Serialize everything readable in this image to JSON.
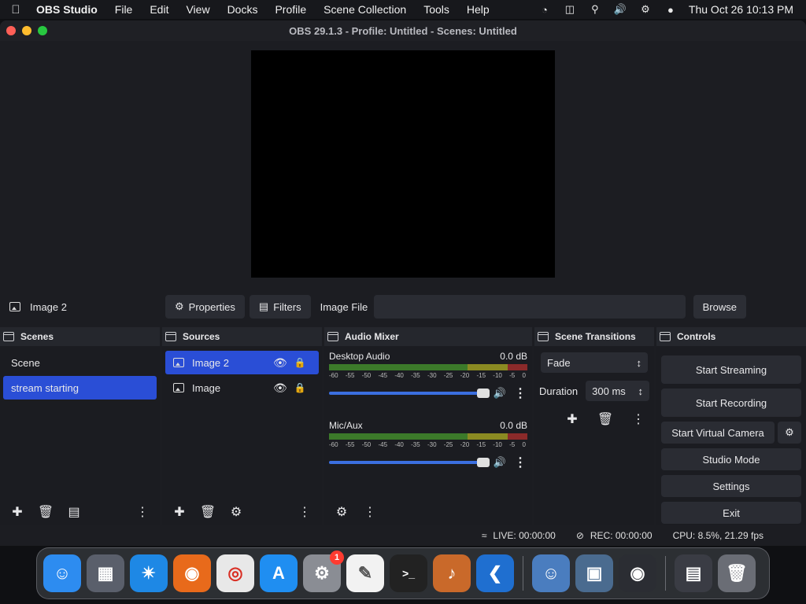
{
  "menubar": {
    "app_name": "OBS Studio",
    "menus": [
      "File",
      "Edit",
      "View",
      "Docks",
      "Profile",
      "Scene Collection",
      "Tools",
      "Help"
    ],
    "clock": "Thu Oct 26  10:13 PM"
  },
  "window": {
    "title": "OBS 29.1.3 - Profile: Untitled - Scenes: Untitled"
  },
  "source_toolbar": {
    "selected_source": "Image 2",
    "properties_label": "Properties",
    "filters_label": "Filters",
    "image_file_label": "Image File",
    "image_file_value": "",
    "browse_label": "Browse"
  },
  "scenes": {
    "title": "Scenes",
    "items": [
      "Scene",
      "stream starting"
    ],
    "selected_index": 1
  },
  "sources": {
    "title": "Sources",
    "items": [
      "Image 2",
      "Image"
    ],
    "selected_index": 0
  },
  "audio_mixer": {
    "title": "Audio Mixer",
    "ticks": [
      "-60",
      "-55",
      "-50",
      "-45",
      "-40",
      "-35",
      "-30",
      "-25",
      "-20",
      "-15",
      "-10",
      "-5",
      "0"
    ],
    "channels": [
      {
        "name": "Desktop Audio",
        "level": "0.0 dB"
      },
      {
        "name": "Mic/Aux",
        "level": "0.0 dB"
      }
    ]
  },
  "transitions": {
    "title": "Scene Transitions",
    "selected": "Fade",
    "duration_label": "Duration",
    "duration_value": "300 ms"
  },
  "controls": {
    "title": "Controls",
    "start_streaming": "Start Streaming",
    "start_recording": "Start Recording",
    "start_virtual_camera": "Start Virtual Camera",
    "studio_mode": "Studio Mode",
    "settings": "Settings",
    "exit": "Exit"
  },
  "status": {
    "live": "LIVE: 00:00:00",
    "rec": "REC: 00:00:00",
    "cpu": "CPU: 8.5%, 21.29 fps"
  },
  "dock_apps": [
    {
      "icon": "finder-icon",
      "color": "#2d8cf0"
    },
    {
      "icon": "launchpad-icon",
      "color": "#5a5f6b"
    },
    {
      "icon": "safari-icon",
      "color": "#1e88e5"
    },
    {
      "icon": "firefox-icon",
      "color": "#e86a1b"
    },
    {
      "icon": "chrome-icon",
      "color": "#e8e8e8"
    },
    {
      "icon": "app-store-icon",
      "color": "#1f8ef1"
    },
    {
      "icon": "system-settings-icon",
      "color": "#8a8d94",
      "badge": "1"
    },
    {
      "icon": "textedit-icon",
      "color": "#f2f2f2"
    },
    {
      "icon": "terminal-icon",
      "color": "#222"
    },
    {
      "icon": "garageband-icon",
      "color": "#c9692a"
    },
    {
      "icon": "vscode-icon",
      "color": "#1f6fd0"
    }
  ],
  "dock_apps_right": [
    {
      "icon": "finder-alt-icon",
      "color": "#4a7dbf"
    },
    {
      "icon": "preview-icon",
      "color": "#4a6b8f"
    },
    {
      "icon": "obs-icon",
      "color": "#2b2d33"
    }
  ],
  "dock_extra": [
    {
      "icon": "downloads-stack-icon",
      "color": "#3a3c44"
    },
    {
      "icon": "trash-icon",
      "color": "#6a6d75"
    }
  ]
}
